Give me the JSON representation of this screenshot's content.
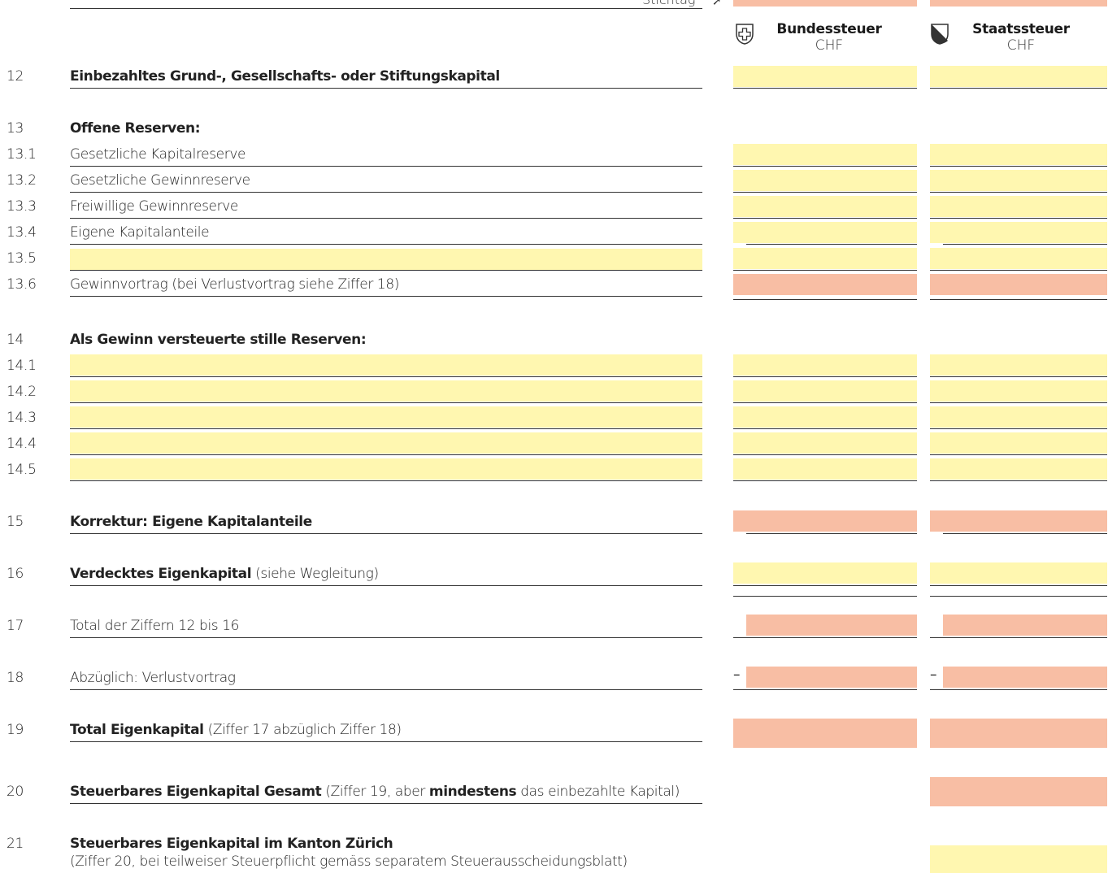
{
  "top": {
    "stichtag_label": "Stichtag"
  },
  "columns": {
    "federal": {
      "title": "Bundessteuer",
      "currency": "CHF",
      "icon": "swiss-cross-shield-icon"
    },
    "state": {
      "title": "Staatssteuer",
      "currency": "CHF",
      "icon": "zurich-shield-icon"
    }
  },
  "rows": {
    "r12": {
      "num": "12",
      "label": "Einbezahltes Grund-, Gesellschafts- oder Stiftungskapital"
    },
    "r13": {
      "num": "13",
      "label": "Offene Reserven:"
    },
    "r13_1": {
      "num": "13.1",
      "label": "Gesetzliche Kapitalreserve"
    },
    "r13_2": {
      "num": "13.2",
      "label": "Gesetzliche Gewinnreserve"
    },
    "r13_3": {
      "num": "13.3",
      "label": "Freiwillige Gewinnreserve"
    },
    "r13_4": {
      "num": "13.4",
      "label": "Eigene Kapitalanteile"
    },
    "r13_5": {
      "num": "13.5",
      "label": ""
    },
    "r13_6": {
      "num": "13.6",
      "label": "Gewinnvortrag (bei Verlustvortrag siehe Ziffer 18)"
    },
    "r14": {
      "num": "14",
      "label": "Als Gewinn versteuerte stille Reserven:"
    },
    "r14_1": {
      "num": "14.1"
    },
    "r14_2": {
      "num": "14.2"
    },
    "r14_3": {
      "num": "14.3"
    },
    "r14_4": {
      "num": "14.4"
    },
    "r14_5": {
      "num": "14.5"
    },
    "r15": {
      "num": "15",
      "label": "Korrektur: Eigene Kapitalanteile"
    },
    "r16": {
      "num": "16",
      "label_bold": "Verdecktes Eigenkapital",
      "label_rest": " (siehe Wegleitung)"
    },
    "r17": {
      "num": "17",
      "label": "Total der Ziffern 12 bis 16"
    },
    "r18": {
      "num": "18",
      "label": "Abzüglich: Verlustvortrag",
      "minus": "–"
    },
    "r19": {
      "num": "19",
      "label_bold": "Total Eigenkapital",
      "label_rest": " (Ziffer 17 abzüglich Ziffer 18)"
    },
    "r20": {
      "num": "20",
      "label_bold": "Steuerbares Eigenkapital Gesamt",
      "label_mid": " (Ziffer 19, aber ",
      "label_bold2": "mindestens",
      "label_rest": " das einbezahlte Kapital)"
    },
    "r21": {
      "num": "21",
      "label_bold": "Steuerbares Eigenkapital im Kanton Zürich",
      "label_line2": "(Ziffer 20, bei teilweiser Steuerpflicht gemäss separatem Steuerausscheidungsblatt)"
    }
  },
  "colors": {
    "field_yellow": "#fff7b0",
    "field_salmon": "#f8bea4"
  }
}
